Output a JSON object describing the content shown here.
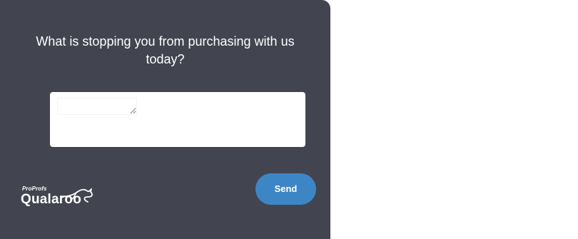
{
  "survey": {
    "question": "What is stopping you from purchasing with us today?",
    "answer_value": "",
    "send_label": "Send"
  },
  "brand": {
    "sub": "ProProfs",
    "name": "Qualaroo"
  },
  "colors": {
    "panel_background": "#42454f",
    "send_button": "#3d86c6",
    "page_background": "#ffffff"
  },
  "icons": [
    "kangaroo-logo-icon"
  ]
}
